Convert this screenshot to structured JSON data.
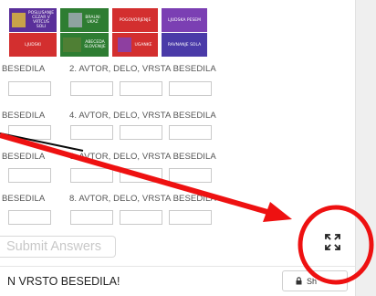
{
  "tiles": [
    {
      "label": "POSLUSANJE\nCEZAR V\nVRTCUŠ SOLI",
      "color": "#5a2f9a"
    },
    {
      "label": "BRALNI\nUKAZ",
      "color": "#2e7d32"
    },
    {
      "label": "POGOVORJENJE",
      "color": "#d32f2f"
    },
    {
      "label": "LJUDSKA PESEM",
      "color": "#7b3fb3"
    },
    {
      "label": "LJUDSKI",
      "color": "#d32f2f"
    },
    {
      "label": "ABECEDA\nSLOVENIJE",
      "color": "#2e7d32"
    },
    {
      "label": "UGANKE",
      "color": "#d32f2f"
    },
    {
      "label": "RAVNANJE SOLA",
      "color": "#4a3aa8"
    }
  ],
  "questions": [
    {
      "left": "BESEDILA",
      "right": "2. AVTOR, DELO, VRSTA BESEDILA"
    },
    {
      "left": "BESEDILA",
      "right": "4. AVTOR, DELO, VRSTA BESEDILA"
    },
    {
      "left": "BESEDILA",
      "right": "6. AVTOR, DELO, VRSTA BESEDILA"
    },
    {
      "left": "BESEDILA",
      "right": "8. AVTOR, DELO, VRSTA BESEDILA"
    }
  ],
  "submit_label": "Submit Answers",
  "footer_title": "N VRSTO BESEDILA!",
  "share_label": "Sh",
  "colors": {
    "annotation_red": "#ee1111",
    "accent_text": "#555555"
  },
  "icons": {
    "lock": "lock-icon",
    "expand": "expand-icon",
    "arrow": "arrow-annotation"
  }
}
